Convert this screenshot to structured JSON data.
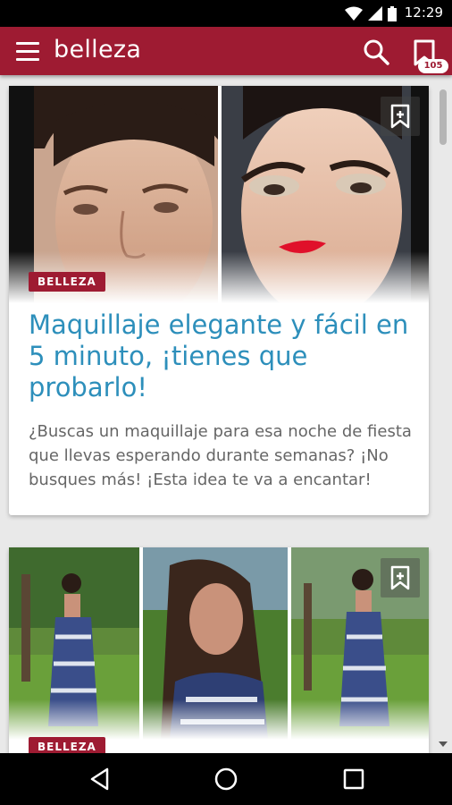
{
  "status_bar": {
    "time": "12:29",
    "icons": [
      "wifi-icon",
      "cell-signal-icon",
      "battery-icon"
    ]
  },
  "app_bar": {
    "title": "belleza",
    "bookmark_count": "105",
    "icons": [
      "menu-icon",
      "search-icon",
      "bookmarks-icon"
    ]
  },
  "colors": {
    "brand": "#9e1b32",
    "title_blue": "#2d8fbb",
    "excerpt_gray": "#666666"
  },
  "feed": {
    "cards": [
      {
        "category": "BELLEZA",
        "title": "Maquillaje elegante y fácil en 5 minuto, ¡tienes que probarlo!",
        "excerpt": "¿Buscas un maquillaje para esa noche de fiesta que llevas esperando durante semanas? ¡No busques más! ¡Esta idea te va a encantar!"
      },
      {
        "category": "BELLEZA"
      }
    ]
  },
  "nav_bar": {
    "icons": [
      "back-icon",
      "home-icon",
      "recents-icon"
    ]
  }
}
